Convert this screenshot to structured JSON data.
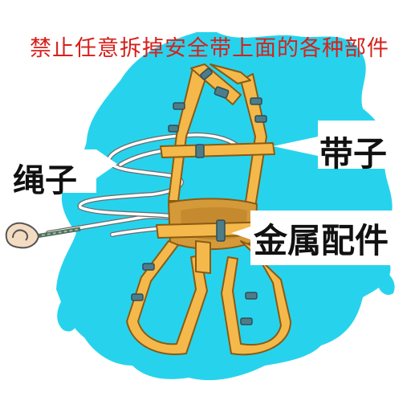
{
  "warning_text": "禁止任意拆掉安全带上面的各种部件",
  "labels": {
    "rope": "绳子",
    "strap": "带子",
    "metal_parts": "金属配件"
  },
  "colors": {
    "title": "#d6201c",
    "backdrop": "#27d3ec",
    "strap": "#f4b94a",
    "strap_outline": "#8a5a14",
    "buckle": "#4e7c8a",
    "rope": "#ffffff",
    "label_bg": "#ffffff",
    "label_text": "#111111"
  }
}
